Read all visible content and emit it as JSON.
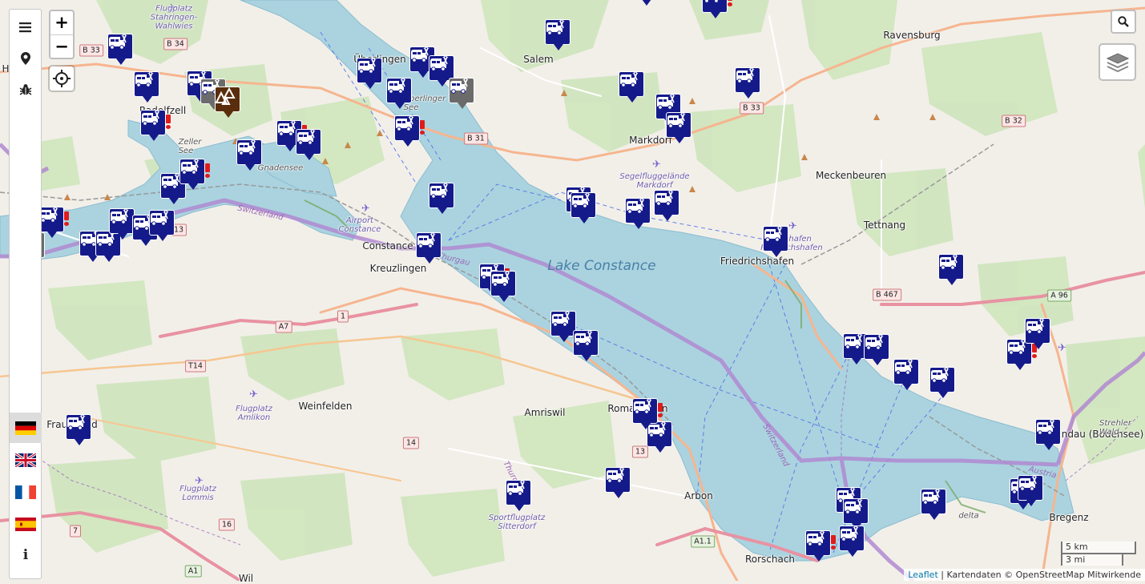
{
  "map": {
    "lake_name": "Lake Constance",
    "places": [
      {
        "name": "Ravensburg",
        "cls": "city"
      },
      {
        "name": "Überlingen",
        "cls": "city"
      },
      {
        "name": "Salem",
        "cls": "city"
      },
      {
        "name": "Radolfzell",
        "cls": "city"
      },
      {
        "name": "Markdorf",
        "cls": "city"
      },
      {
        "name": "Meckenbeuren",
        "cls": "city"
      },
      {
        "name": "Tettnang",
        "cls": "city"
      },
      {
        "name": "Friedrichshafen",
        "cls": "city"
      },
      {
        "name": "Constance",
        "cls": "city"
      },
      {
        "name": "Kreuzlingen",
        "cls": "city"
      },
      {
        "name": "Weinfelden",
        "cls": "city"
      },
      {
        "name": "Amriswil",
        "cls": "city"
      },
      {
        "name": "Romanshorn",
        "cls": "city"
      },
      {
        "name": "Arbon",
        "cls": "city"
      },
      {
        "name": "Rorschach",
        "cls": "city"
      },
      {
        "name": "Lindau (Bodensee)",
        "cls": "city"
      },
      {
        "name": "Bregenz",
        "cls": "city"
      },
      {
        "name": "Frauenfeld",
        "cls": "city"
      },
      {
        "name": "Holl",
        "cls": "city"
      },
      {
        "name": "Wil",
        "cls": "city"
      },
      {
        "name": "Zeller\nSee",
        "cls": "minor"
      },
      {
        "name": "Gnadensee",
        "cls": "minor"
      },
      {
        "name": "Überlinger\nSee",
        "cls": "minor"
      },
      {
        "name": "Switzerland",
        "cls": "border"
      },
      {
        "name": "Switzerland",
        "cls": "border"
      },
      {
        "name": "Thurgau",
        "cls": "border"
      },
      {
        "name": "Thurgau",
        "cls": "border"
      },
      {
        "name": "Austria",
        "cls": "border"
      },
      {
        "name": "Flugplatz\nStahringen-\nWahlwies",
        "cls": "airport"
      },
      {
        "name": "Airport\nConstance",
        "cls": "airport"
      },
      {
        "name": "Segelfluggelände\nMarkdorf",
        "cls": "airport"
      },
      {
        "name": "Flughafen\nFriedrichshafen",
        "cls": "airport"
      },
      {
        "name": "Flugplatz\nAmlikon",
        "cls": "airport"
      },
      {
        "name": "Flugplatz\nLommis",
        "cls": "airport"
      },
      {
        "name": "Sportflugplatz\nSitterdorf",
        "cls": "airport"
      },
      {
        "name": "Strehler\nWald",
        "cls": "minor"
      },
      {
        "name": "delta",
        "cls": "minor"
      }
    ],
    "road_shields": [
      {
        "label": "B 33",
        "style": "red"
      },
      {
        "label": "B 34",
        "style": "red"
      },
      {
        "label": "B 31",
        "style": "red"
      },
      {
        "label": "B 33",
        "style": "red"
      },
      {
        "label": "B 32",
        "style": "red"
      },
      {
        "label": "B 467",
        "style": "red"
      },
      {
        "label": "A 96",
        "style": "green"
      },
      {
        "label": "A7",
        "style": "red"
      },
      {
        "label": "T14",
        "style": "red"
      },
      {
        "label": "1",
        "style": "red"
      },
      {
        "label": "14",
        "style": "red"
      },
      {
        "label": "13",
        "style": "red"
      },
      {
        "label": "13",
        "style": "red"
      },
      {
        "label": "16",
        "style": "red"
      },
      {
        "label": "7",
        "style": "red"
      },
      {
        "label": "A1",
        "style": "green"
      },
      {
        "label": "A1.1",
        "style": "green"
      }
    ],
    "markers": [
      {
        "type": "camper",
        "alert": false
      },
      {
        "type": "camper",
        "alert": false
      },
      {
        "type": "camper",
        "alert": true
      },
      {
        "type": "camper",
        "alert": false
      },
      {
        "type": "camper",
        "alert": false
      },
      {
        "type": "camper",
        "alert": true
      },
      {
        "type": "camper",
        "alert": false
      },
      {
        "type": "camper",
        "alert": true
      },
      {
        "type": "camper",
        "alert": false
      },
      {
        "type": "camper",
        "alert": false
      },
      {
        "type": "camper",
        "alert": false
      },
      {
        "type": "camper",
        "alert": false
      },
      {
        "type": "camper",
        "alert": false
      },
      {
        "type": "camper",
        "alert": true
      },
      {
        "type": "camper",
        "alert": false
      },
      {
        "type": "camper",
        "alert": false
      },
      {
        "type": "camper",
        "alert": true
      },
      {
        "type": "camper",
        "alert": false
      },
      {
        "type": "camper",
        "alert": false
      },
      {
        "type": "camper",
        "alert": false
      },
      {
        "type": "camper",
        "alert": false
      },
      {
        "type": "camper",
        "alert": false
      },
      {
        "type": "camper",
        "alert": false
      },
      {
        "type": "camper",
        "alert": false
      },
      {
        "type": "camper",
        "alert": false
      },
      {
        "type": "camper",
        "alert": false
      },
      {
        "type": "camper",
        "alert": false
      },
      {
        "type": "camper",
        "alert": false
      },
      {
        "type": "camper",
        "alert": false
      },
      {
        "type": "camper",
        "alert": true
      },
      {
        "type": "camper",
        "alert": false
      },
      {
        "type": "camper",
        "alert": false
      },
      {
        "type": "camper",
        "alert": false
      },
      {
        "type": "camper",
        "alert": false
      },
      {
        "type": "camper",
        "alert": false
      },
      {
        "type": "camper",
        "alert": false
      },
      {
        "type": "camper",
        "alert": false
      },
      {
        "type": "camper",
        "alert": true
      },
      {
        "type": "camper",
        "alert": false
      },
      {
        "type": "camper",
        "alert": false
      },
      {
        "type": "camper",
        "alert": false
      },
      {
        "type": "camper",
        "alert": false
      },
      {
        "type": "camper",
        "alert": false
      },
      {
        "type": "camper",
        "alert": false
      },
      {
        "type": "camper",
        "alert": false
      },
      {
        "type": "camper",
        "alert": false
      },
      {
        "type": "camper",
        "alert": true
      },
      {
        "type": "camper",
        "alert": false
      },
      {
        "type": "camper",
        "alert": false
      },
      {
        "type": "camper",
        "alert": false
      },
      {
        "type": "camper",
        "alert": true
      },
      {
        "type": "camper",
        "alert": false
      },
      {
        "type": "camper",
        "alert": true
      },
      {
        "type": "camper",
        "alert": false
      },
      {
        "type": "camper",
        "alert": false
      },
      {
        "type": "camper",
        "alert": false
      },
      {
        "type": "camper",
        "alert": false
      },
      {
        "type": "camper",
        "alert": false
      },
      {
        "type": "grey",
        "alert": false
      },
      {
        "type": "grey",
        "alert": false
      },
      {
        "type": "grey",
        "alert": false
      },
      {
        "type": "campsite",
        "alert": false
      }
    ]
  },
  "sidebar": {
    "menu_icon": "hamburger-menu-icon",
    "location_icon": "map-pin-icon",
    "bug_icon": "bug-icon",
    "languages": [
      "de",
      "en",
      "fr",
      "es"
    ],
    "active_language": "de",
    "info_label": "i"
  },
  "controls": {
    "zoom_in": "+",
    "zoom_out": "−",
    "locate_icon": "crosshair-icon",
    "search_icon": "search-icon",
    "layers_icon": "layers-icon"
  },
  "scale": {
    "metric": "5 km",
    "imperial": "3 mi"
  },
  "attribution": {
    "leaflet": "Leaflet",
    "separator": " | ",
    "text": "Kartendaten © OpenStreetMap Mitwirkende"
  },
  "colors": {
    "water": "#aad3df",
    "marker": "#151a8a",
    "border": "#b08ad1",
    "land": "#f2efe9"
  }
}
